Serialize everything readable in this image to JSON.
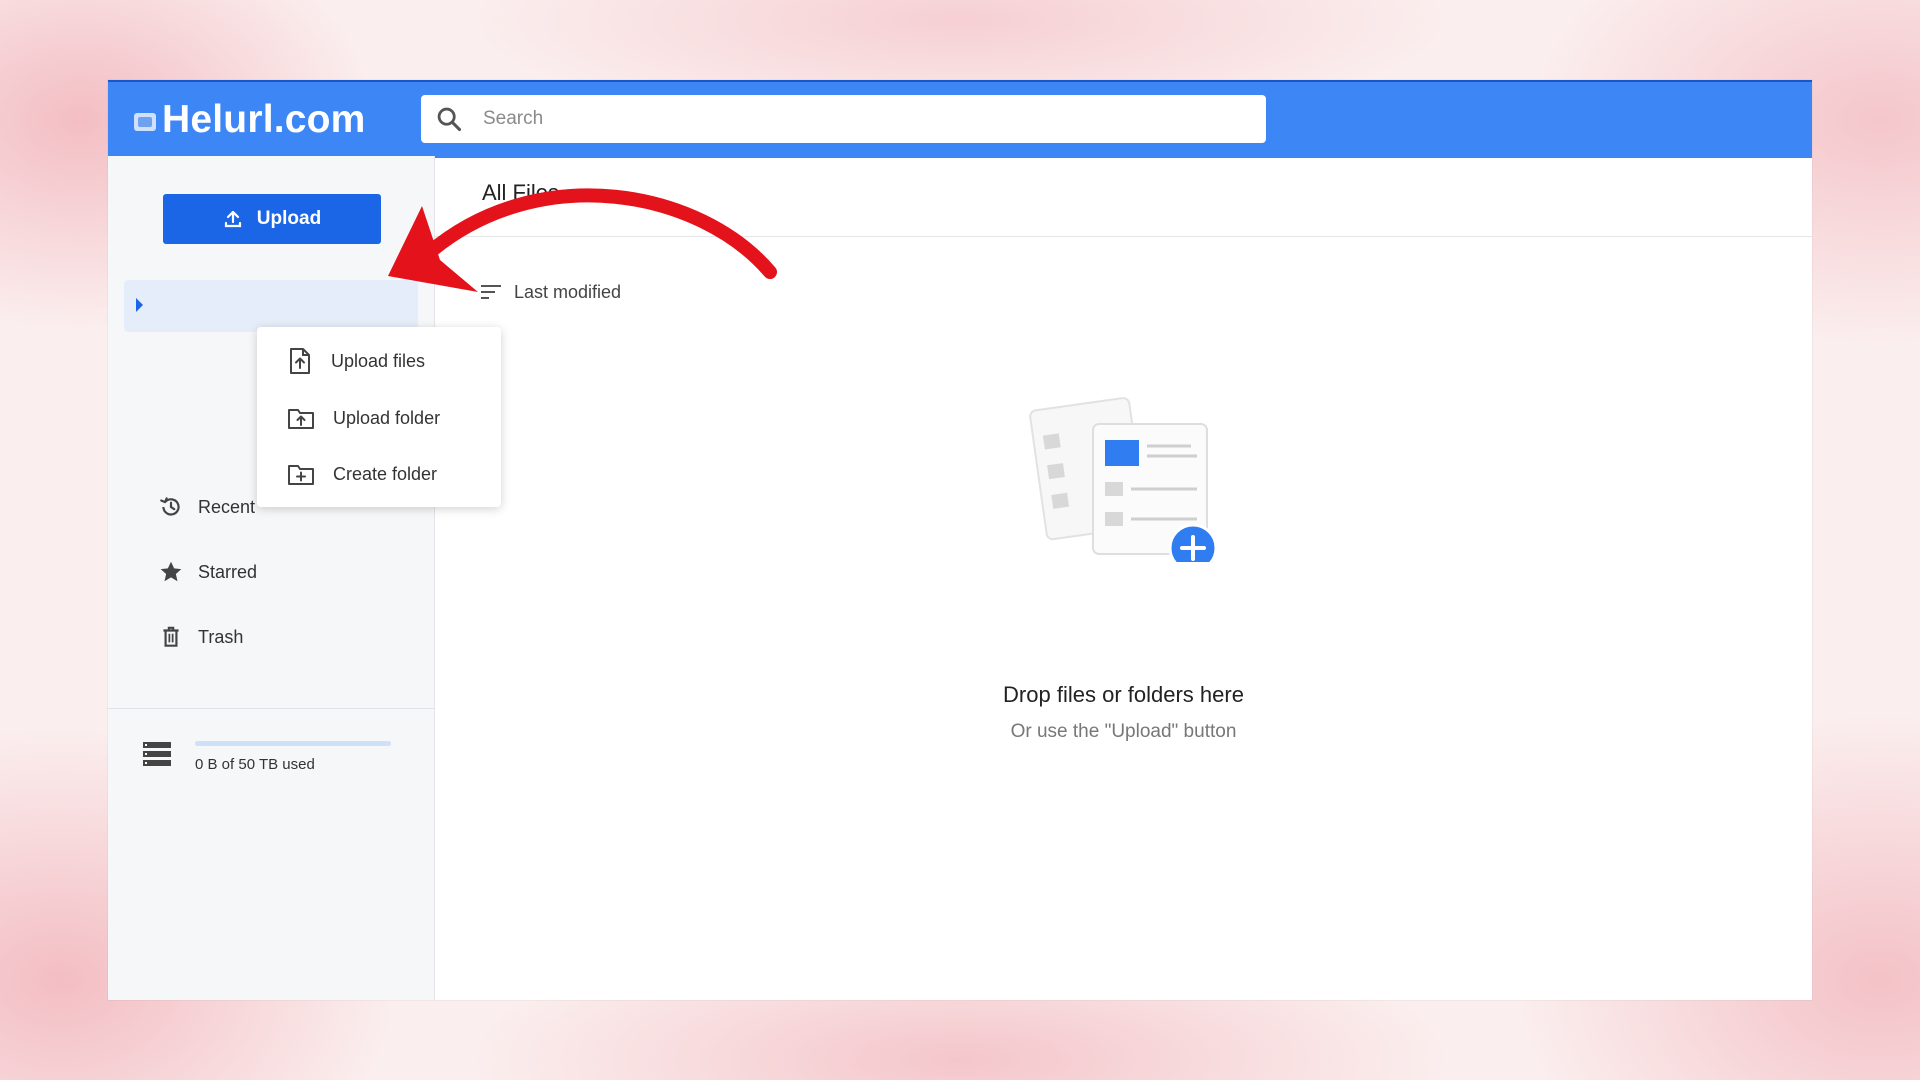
{
  "app": {
    "logo_text": "Helurl.com"
  },
  "search": {
    "placeholder": "Search",
    "value": ""
  },
  "sidebar": {
    "upload_label": "Upload",
    "items": [
      {
        "label": "Recent",
        "icon": "history-icon"
      },
      {
        "label": "Starred",
        "icon": "star-icon"
      },
      {
        "label": "Trash",
        "icon": "trash-icon"
      }
    ],
    "storage": {
      "text": "0 B of 50 TB used",
      "used_fraction": 0
    }
  },
  "upload_menu": {
    "items": [
      {
        "label": "Upload files",
        "icon": "file-upload-icon"
      },
      {
        "label": "Upload folder",
        "icon": "folder-upload-icon"
      },
      {
        "label": "Create folder",
        "icon": "folder-add-icon"
      }
    ]
  },
  "main": {
    "breadcrumb": "All Files",
    "sort_label": "Last modified",
    "empty_title": "Drop files or folders here",
    "empty_subtitle": "Or use the \"Upload\" button"
  },
  "colors": {
    "accent": "#3d86f5",
    "button": "#1a66e6",
    "annotation_arrow": "#e3121b"
  }
}
